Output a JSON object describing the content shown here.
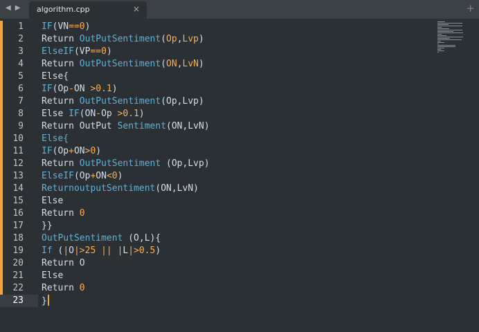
{
  "tab": {
    "filename": "algorithm.cpp",
    "close_icon": "×",
    "new_tab_icon": "+"
  },
  "nav": {
    "back": "◀",
    "forward": "▶"
  },
  "active_line": 23,
  "lines": [
    {
      "number": "1",
      "tokens": [
        {
          "t": "IF",
          "c": "k"
        },
        {
          "t": "(VN",
          "c": "p"
        },
        {
          "t": "==",
          "c": "o"
        },
        {
          "t": "0",
          "c": "o"
        },
        {
          "t": ")",
          "c": "p"
        }
      ]
    },
    {
      "number": "2",
      "tokens": [
        {
          "t": "Return ",
          "c": "p"
        },
        {
          "t": "OutPutSentiment",
          "c": "k"
        },
        {
          "t": "(",
          "c": "p"
        },
        {
          "t": "Op",
          "c": "o"
        },
        {
          "t": ",",
          "c": "p"
        },
        {
          "t": "Lvp",
          "c": "o"
        },
        {
          "t": ")",
          "c": "p"
        }
      ]
    },
    {
      "number": "3",
      "tokens": [
        {
          "t": "ElseIF",
          "c": "k"
        },
        {
          "t": "(VP",
          "c": "p"
        },
        {
          "t": "==",
          "c": "o"
        },
        {
          "t": "0",
          "c": "o"
        },
        {
          "t": ")",
          "c": "p"
        }
      ]
    },
    {
      "number": "4",
      "tokens": [
        {
          "t": "Return ",
          "c": "p"
        },
        {
          "t": "OutPutSentiment",
          "c": "k"
        },
        {
          "t": "(",
          "c": "p"
        },
        {
          "t": "ON",
          "c": "o"
        },
        {
          "t": ",",
          "c": "p"
        },
        {
          "t": "LvN",
          "c": "o"
        },
        {
          "t": ")",
          "c": "p"
        }
      ]
    },
    {
      "number": "5",
      "tokens": [
        {
          "t": "Else{",
          "c": "p"
        }
      ]
    },
    {
      "number": "6",
      "tokens": [
        {
          "t": "IF",
          "c": "k"
        },
        {
          "t": "(Op",
          "c": "p"
        },
        {
          "t": "-",
          "c": "o"
        },
        {
          "t": "ON ",
          "c": "p"
        },
        {
          "t": ">",
          "c": "o"
        },
        {
          "t": "0.1",
          "c": "o"
        },
        {
          "t": ")",
          "c": "p"
        }
      ]
    },
    {
      "number": "7",
      "tokens": [
        {
          "t": "Return ",
          "c": "p"
        },
        {
          "t": "OutPutSentiment",
          "c": "k"
        },
        {
          "t": "(Op,Lvp)",
          "c": "p"
        }
      ]
    },
    {
      "number": "8",
      "tokens": [
        {
          "t": "Else ",
          "c": "p"
        },
        {
          "t": "IF",
          "c": "k"
        },
        {
          "t": "(ON",
          "c": "p"
        },
        {
          "t": "-",
          "c": "o"
        },
        {
          "t": "Op ",
          "c": "p"
        },
        {
          "t": ">",
          "c": "o"
        },
        {
          "t": "0.1",
          "c": "o"
        },
        {
          "t": ")",
          "c": "p"
        }
      ]
    },
    {
      "number": "9",
      "tokens": [
        {
          "t": "Return OutPut ",
          "c": "p"
        },
        {
          "t": "Sentiment",
          "c": "k"
        },
        {
          "t": "(ON,LvN)",
          "c": "p"
        }
      ]
    },
    {
      "number": "10",
      "tokens": [
        {
          "t": "Else{",
          "c": "k"
        }
      ]
    },
    {
      "number": "11",
      "tokens": [
        {
          "t": "IF",
          "c": "k"
        },
        {
          "t": "(Op",
          "c": "p"
        },
        {
          "t": "+",
          "c": "o"
        },
        {
          "t": "ON",
          "c": "p"
        },
        {
          "t": ">",
          "c": "o"
        },
        {
          "t": "0",
          "c": "o"
        },
        {
          "t": ")",
          "c": "p"
        }
      ]
    },
    {
      "number": "12",
      "tokens": [
        {
          "t": "Return ",
          "c": "p"
        },
        {
          "t": "OutPutSentiment",
          "c": "k"
        },
        {
          "t": " (Op,Lvp)",
          "c": "p"
        }
      ]
    },
    {
      "number": "13",
      "tokens": [
        {
          "t": "ElseIF",
          "c": "k"
        },
        {
          "t": "(Op",
          "c": "p"
        },
        {
          "t": "+",
          "c": "o"
        },
        {
          "t": "ON",
          "c": "p"
        },
        {
          "t": "<",
          "c": "o"
        },
        {
          "t": "0",
          "c": "o"
        },
        {
          "t": ")",
          "c": "p"
        }
      ]
    },
    {
      "number": "14",
      "tokens": [
        {
          "t": "ReturnoutputSentiment",
          "c": "k"
        },
        {
          "t": "(ON,LvN)",
          "c": "p"
        }
      ]
    },
    {
      "number": "15",
      "tokens": [
        {
          "t": "Else",
          "c": "p"
        }
      ]
    },
    {
      "number": "16",
      "tokens": [
        {
          "t": "Return ",
          "c": "p"
        },
        {
          "t": "0",
          "c": "o"
        }
      ]
    },
    {
      "number": "17",
      "tokens": [
        {
          "t": "}}",
          "c": "p"
        }
      ]
    },
    {
      "number": "18",
      "tokens": [
        {
          "t": "OutPutSentiment",
          "c": "k"
        },
        {
          "t": " (O,L){",
          "c": "p"
        }
      ]
    },
    {
      "number": "19",
      "tokens": [
        {
          "t": "If",
          "c": "k"
        },
        {
          "t": " (",
          "c": "p"
        },
        {
          "t": "|",
          "c": "o"
        },
        {
          "t": "O",
          "c": "p"
        },
        {
          "t": "|",
          "c": "o"
        },
        {
          "t": ">",
          "c": "o"
        },
        {
          "t": "25",
          "c": "o"
        },
        {
          "t": " ",
          "c": "p"
        },
        {
          "t": "||",
          "c": "o"
        },
        {
          "t": " ",
          "c": "p"
        },
        {
          "t": "|",
          "c": "o"
        },
        {
          "t": "L",
          "c": "p"
        },
        {
          "t": "|",
          "c": "o"
        },
        {
          "t": ">",
          "c": "o"
        },
        {
          "t": "0.5",
          "c": "o"
        },
        {
          "t": ")",
          "c": "p"
        }
      ]
    },
    {
      "number": "20",
      "tokens": [
        {
          "t": "Return O",
          "c": "p"
        }
      ]
    },
    {
      "number": "21",
      "tokens": [
        {
          "t": "Else",
          "c": "p"
        }
      ]
    },
    {
      "number": "22",
      "tokens": [
        {
          "t": "Return ",
          "c": "p"
        },
        {
          "t": "0",
          "c": "o"
        }
      ]
    },
    {
      "number": "23",
      "tokens": [
        {
          "t": "}",
          "c": "p"
        }
      ]
    }
  ],
  "colors": {
    "keyword": "#5fb3d6",
    "operator": "#f9ae58",
    "plain": "#d8dee9",
    "accent": "#f0a43c"
  }
}
